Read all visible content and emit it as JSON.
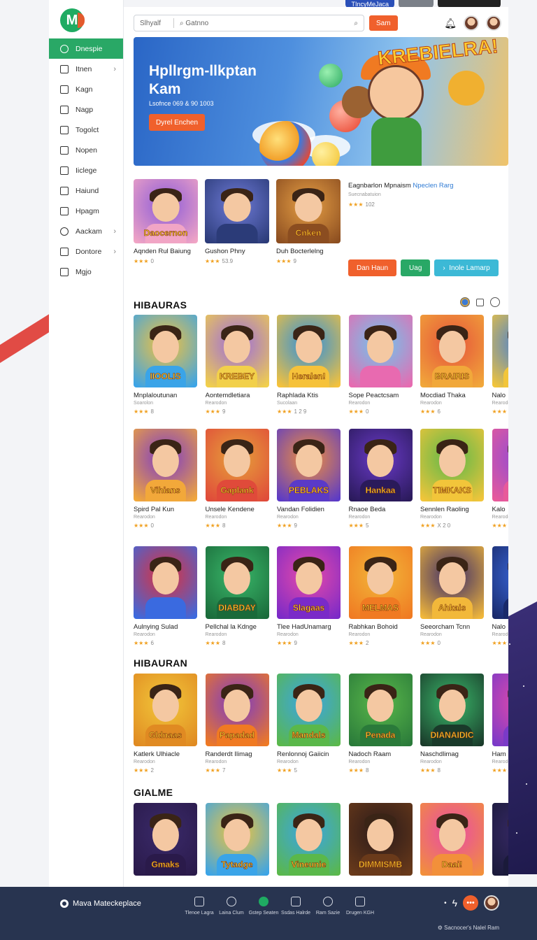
{
  "top_pills": [
    {
      "label": "TIncyMeJaca",
      "color": "#2a4fb8"
    },
    {
      "label": "",
      "color": "#7b8088"
    },
    {
      "label": "",
      "color": "#222222"
    }
  ],
  "sidebar": {
    "logo_letter": "M",
    "items": [
      {
        "label": "Dnespie",
        "icon": "home-icon",
        "active": true,
        "chevron": false
      },
      {
        "label": "Itnen",
        "icon": "list-icon",
        "active": false,
        "chevron": true
      },
      {
        "label": "Kagn",
        "icon": "square-icon",
        "active": false,
        "chevron": false
      },
      {
        "label": "Nagp",
        "icon": "home-outline-icon",
        "active": false,
        "chevron": false
      },
      {
        "label": "Togolct",
        "icon": "document-icon",
        "active": false,
        "chevron": false
      },
      {
        "label": "Nopen",
        "icon": "chat-icon",
        "active": false,
        "chevron": false
      },
      {
        "label": "Iiclege",
        "icon": "file-icon",
        "active": false,
        "chevron": false
      },
      {
        "label": "Haiund",
        "icon": "shield-icon",
        "active": false,
        "chevron": false
      },
      {
        "label": "Hpagm",
        "icon": "book-icon",
        "active": false,
        "chevron": false
      },
      {
        "label": "Aackam",
        "icon": "user-icon",
        "active": false,
        "chevron": true
      },
      {
        "label": "Dontore",
        "icon": "grid-icon",
        "active": false,
        "chevron": true
      },
      {
        "label": "Mgjo",
        "icon": "box-icon",
        "active": false,
        "chevron": false
      }
    ]
  },
  "header": {
    "search_left": "Slhyalf",
    "search_right": "Gatnno",
    "button_label": "Sam"
  },
  "hero": {
    "title": "Hpllrgm-llkptan Kam",
    "subtitle": "Lsofnce 069 & 90 1003",
    "cta_label": "Dyrel Enchen",
    "banner_title": "KREBIELRA!"
  },
  "featured": {
    "cards": [
      {
        "title": "Aqnden Rul Baiung",
        "rating": "0",
        "tag": "Daocernon",
        "colors": [
          "#8c5bd8",
          "#f1a5c5"
        ]
      },
      {
        "title": "Gushon Phny",
        "rating": "53.9",
        "tag": "",
        "colors": [
          "#6f7bd7",
          "#2b3b78"
        ]
      },
      {
        "title": "Duh Bocterlelng",
        "rating": "9",
        "tag": "Cnken",
        "colors": [
          "#e7a045",
          "#8b4d20"
        ]
      }
    ],
    "promo_title": "Eagnbarlon Mpnaism",
    "promo_title_accent": "Npeclen Rarg",
    "promo_sub": "Suecnabatuion",
    "promo_rating": "102",
    "buttons": [
      "Dan Haun",
      "Uag",
      "Inole Lamarp"
    ]
  },
  "sections": [
    {
      "title": "HIBAURAS",
      "cards": [
        {
          "title": "Mnplaloutunan",
          "sub": "Soarolon",
          "rating": "8",
          "label": "IIOOLIS",
          "colors": [
            "#f6c23a",
            "#3aa4e8"
          ]
        },
        {
          "title": "Aontemdletiara",
          "sub": "Rearodon",
          "rating": "9",
          "label": "KREBEY",
          "colors": [
            "#9b6ae0",
            "#f2d04a"
          ]
        },
        {
          "title": "Raphlada Ktis",
          "sub": "Sucolaan",
          "rating": "1 2 9",
          "label": "Heralen!",
          "colors": [
            "#2c8fe0",
            "#f6c23a"
          ]
        },
        {
          "title": "Sope Peactcsam",
          "sub": "Rearodon",
          "rating": "0",
          "label": "",
          "colors": [
            "#6cc7ef",
            "#e86ab0"
          ]
        },
        {
          "title": "Mocdiad Thaka",
          "sub": "Rearodon",
          "rating": "6",
          "label": "BRAIRIS",
          "colors": [
            "#e6533a",
            "#f1a83a"
          ]
        },
        {
          "title": "Nalo",
          "sub": "Rearodon",
          "rating": "",
          "label": "",
          "colors": [
            "#3a7ae0",
            "#f2c53a"
          ]
        }
      ]
    },
    {
      "title": "",
      "cards": [
        {
          "title": "Spird Pal Kun",
          "sub": "Rearodon",
          "rating": "0",
          "label": "Vihians",
          "colors": [
            "#7c3ac8",
            "#f2a83a"
          ]
        },
        {
          "title": "Unsele Kendene",
          "sub": "Rearodon",
          "rating": "8",
          "label": "Gaplank",
          "colors": [
            "#e6a23a",
            "#e04a3a"
          ]
        },
        {
          "title": "Vandan Folidien",
          "sub": "Rearodon",
          "rating": "9",
          "label": "PEBLAKS",
          "colors": [
            "#f2903a",
            "#5a3ac8"
          ]
        },
        {
          "title": "Rnaoe Beda",
          "sub": "Rearodon",
          "rating": "5",
          "label": "Hankaa",
          "colors": [
            "#6a3ac8",
            "#2a1a5a"
          ]
        },
        {
          "title": "Sennlen Raoling",
          "sub": "Rearodon",
          "rating": "X 2 0",
          "label": "TIMKAKS",
          "colors": [
            "#5ab84a",
            "#f2c53a"
          ]
        },
        {
          "title": "Kalo",
          "sub": "Rearodon",
          "rating": "",
          "label": "",
          "colors": [
            "#8a4ad8",
            "#e85a9a"
          ]
        }
      ]
    },
    {
      "title": "",
      "cards": [
        {
          "title": "Aulnying Sulad",
          "sub": "Rearodon",
          "rating": "6",
          "label": "",
          "colors": [
            "#e0303a",
            "#3a6ae0"
          ]
        },
        {
          "title": "Pellchal la Kdnge",
          "sub": "Rearodon",
          "rating": "8",
          "label": "DIABDAY",
          "colors": [
            "#3ab86a",
            "#1a6a3a"
          ]
        },
        {
          "title": "Tlee HadUnamarg",
          "sub": "Rearodon",
          "rating": "9",
          "label": "Slagaas",
          "colors": [
            "#e84aa8",
            "#7a2ac8"
          ]
        },
        {
          "title": "Rabhkan Bohoid",
          "sub": "Rearodon",
          "rating": "2",
          "label": "MELMAS",
          "colors": [
            "#f2b83a",
            "#f07a22"
          ]
        },
        {
          "title": "Seeorcham Tcnn",
          "sub": "Rearodon",
          "rating": "0",
          "label": "Ahkais",
          "colors": [
            "#3a2a6a",
            "#f2b83a"
          ]
        },
        {
          "title": "Nalo",
          "sub": "Rearodon",
          "rating": "",
          "label": "",
          "colors": [
            "#3a6ae0",
            "#1a2a6a"
          ]
        }
      ]
    },
    {
      "title": "HIBAURAN",
      "cards": [
        {
          "title": "Katlerk Ulhiacle",
          "sub": "Rearodon",
          "rating": "2",
          "label": "Gldnaas",
          "colors": [
            "#f2c83a",
            "#e08a22"
          ]
        },
        {
          "title": "Randerdt Ilimag",
          "sub": "Rearodon",
          "rating": "7",
          "label": "Papadad",
          "colors": [
            "#7a3ac8",
            "#f07a22"
          ]
        },
        {
          "title": "Renlonnoj Gaiicin",
          "sub": "Rearodon",
          "rating": "5",
          "label": "Mandals",
          "colors": [
            "#3aa4e8",
            "#5ab84a"
          ]
        },
        {
          "title": "Nadoch Raam",
          "sub": "Rearodon",
          "rating": "8",
          "label": "Penada",
          "colors": [
            "#5ab84a",
            "#2a7a3a"
          ]
        },
        {
          "title": "Naschdlimag",
          "sub": "Rearodon",
          "rating": "8",
          "label": "DIANAIDIC",
          "colors": [
            "#3ab86a",
            "#1a3a2a"
          ]
        },
        {
          "title": "Ham",
          "sub": "Rearodon",
          "rating": "",
          "label": "",
          "colors": [
            "#e84aa8",
            "#7a3ac8"
          ]
        }
      ]
    },
    {
      "title": "GIALME",
      "cards": [
        {
          "title": "",
          "sub": "",
          "rating": "",
          "label": "Gmaks",
          "colors": [
            "#3a2a6a",
            "#2a1a4a"
          ]
        },
        {
          "title": "",
          "sub": "",
          "rating": "",
          "label": "Tytadge",
          "colors": [
            "#f2c53a",
            "#3aa4e8"
          ]
        },
        {
          "title": "",
          "sub": "",
          "rating": "",
          "label": "Vineunie",
          "colors": [
            "#3aa4e8",
            "#5ab84a"
          ]
        },
        {
          "title": "",
          "sub": "",
          "rating": "",
          "label": "DIMMISMB",
          "colors": [
            "#2a1a1a",
            "#6a3a1a"
          ]
        },
        {
          "title": "",
          "sub": "",
          "rating": "",
          "label": "Daai!",
          "colors": [
            "#e84aa8",
            "#f2903a"
          ]
        },
        {
          "title": "",
          "sub": "",
          "rating": "",
          "label": "",
          "colors": [
            "#3a2a6a",
            "#1a1a3a"
          ]
        }
      ]
    }
  ],
  "footer": {
    "brand": "Mava Mateckeplace",
    "nav": [
      {
        "label": "Tlenoe Lagra",
        "icon": "home-icon"
      },
      {
        "label": "Laina Clum",
        "icon": "search-icon"
      },
      {
        "label": "Gstep Seaten",
        "icon": "circle-icon"
      },
      {
        "label": "Ssdas Halrde",
        "icon": "apps-icon"
      },
      {
        "label": "Ram Sazie",
        "icon": "search-icon"
      },
      {
        "label": "Drugen KGH",
        "icon": "menu-icon"
      }
    ],
    "note": "Sacnocer's Nalel Ram"
  }
}
